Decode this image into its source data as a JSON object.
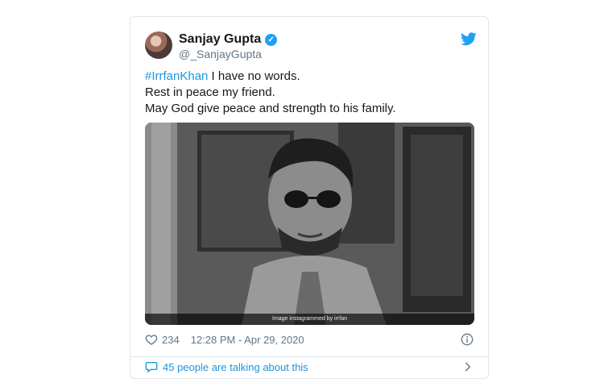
{
  "tweet": {
    "display_name": "Sanjay Gupta",
    "handle": "@_SanjayGupta",
    "hashtag": "#IrrfanKhan",
    "line1_rest": " I have no words.",
    "line2": "Rest in peace my friend.",
    "line3": "May God give peace and strength to his family.",
    "image_caption": "Image instagrammed by irrfan",
    "like_count": "234",
    "timestamp": "12:28 PM - Apr 29, 2020",
    "talking": "45 people are talking about this"
  },
  "colors": {
    "accent": "#1da1f2",
    "link": "#1b95e0",
    "muted": "#657786"
  },
  "icons": [
    "twitter-icon",
    "verified-icon",
    "heart-icon",
    "info-icon",
    "comment-icon",
    "chevron-right-icon"
  ]
}
